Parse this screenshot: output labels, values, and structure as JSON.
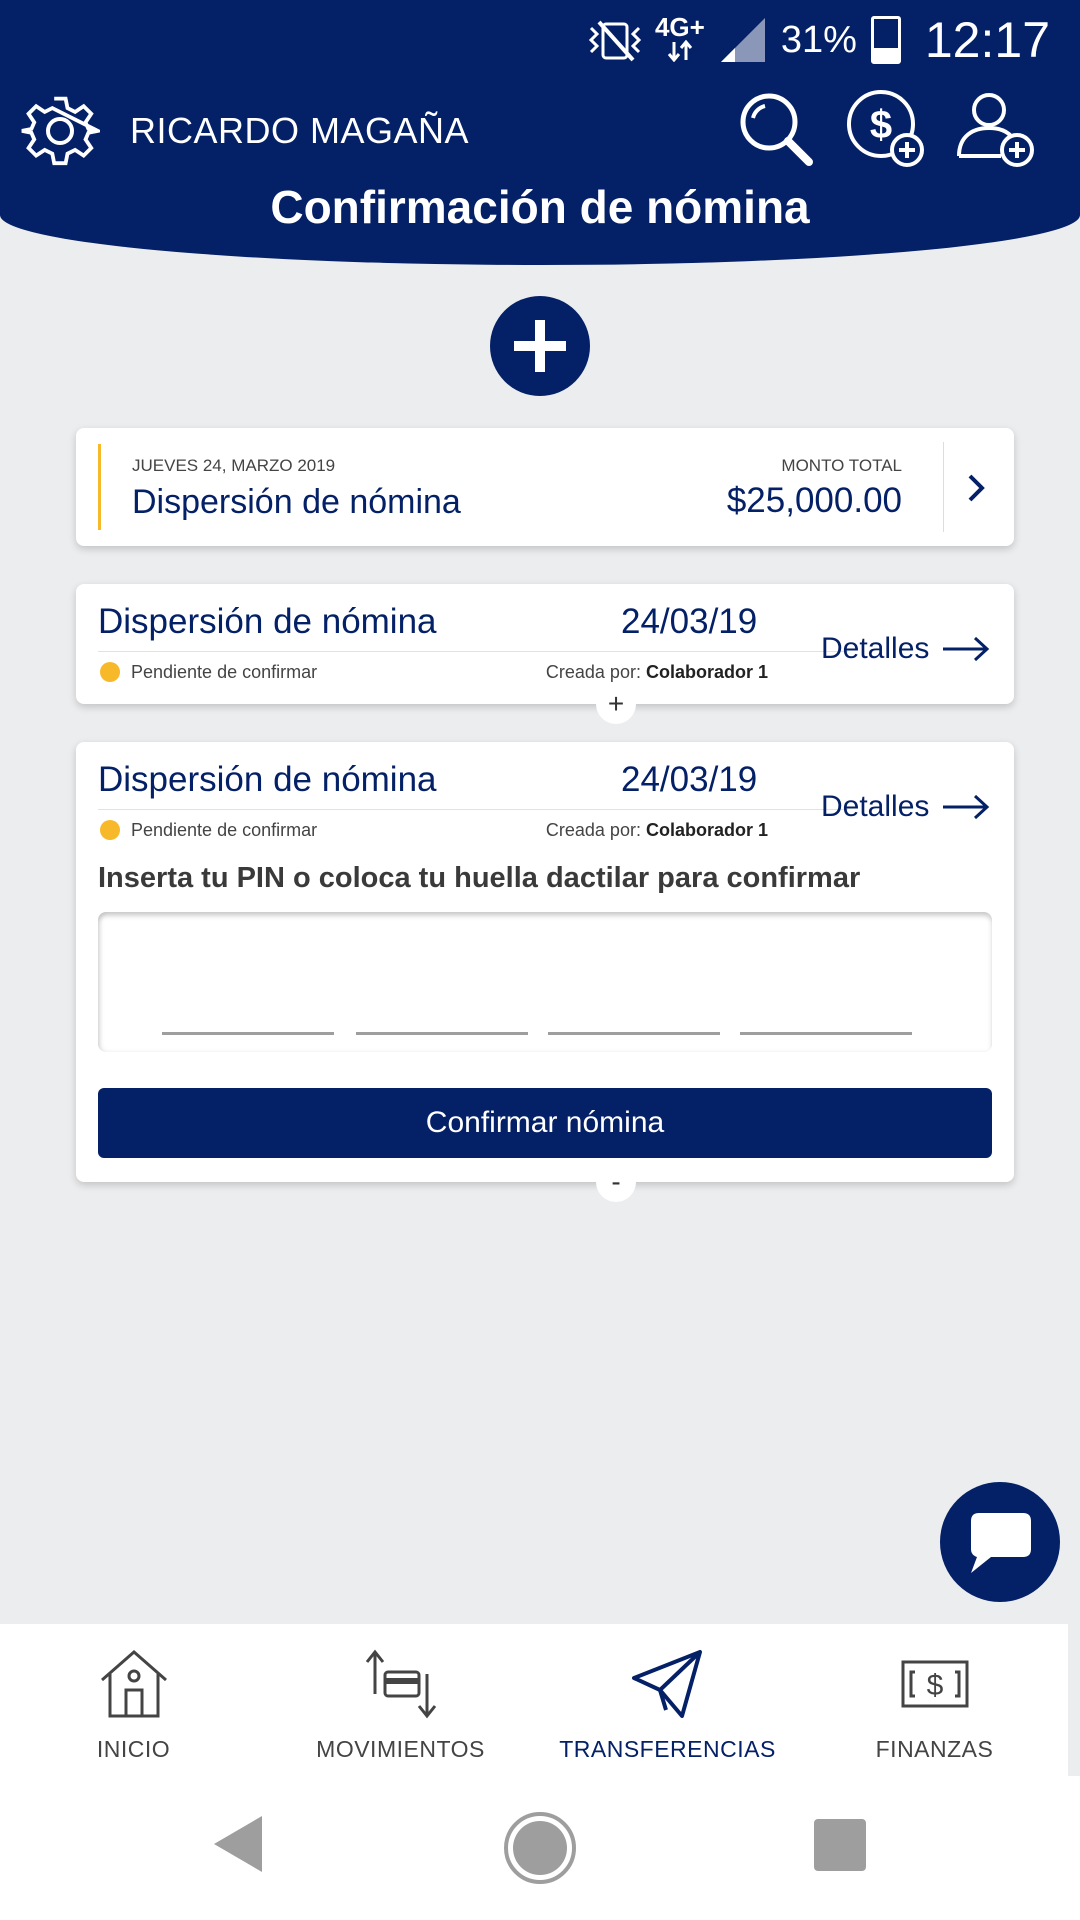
{
  "status_bar": {
    "network": "4G+",
    "battery_percent": "31%",
    "time": "12:17",
    "icons": [
      "vibrate-off-icon",
      "network-arrows-icon",
      "signal-icon",
      "battery-icon"
    ]
  },
  "header": {
    "user_name": "RICARDO MAGAÑA",
    "title": "Confirmación de nómina",
    "icons": [
      "gear-icon",
      "search-icon",
      "add-money-icon",
      "add-user-icon"
    ],
    "color": "#042066"
  },
  "summary": {
    "date": "JUEVES 24, MARZO 2019",
    "title": "Dispersión de nómina",
    "amount_label": "MONTO TOTAL",
    "amount": "$25,000.00"
  },
  "items": [
    {
      "title": "Dispersión de nómina",
      "date": "24/03/19",
      "status": "Pendiente de confirmar",
      "creator_prefix": "Creada por:",
      "creator": "Colaborador 1",
      "details_label": "Detalles",
      "toggle": "+"
    },
    {
      "title": "Dispersión de nómina",
      "date": "24/03/19",
      "status": "Pendiente de confirmar",
      "creator_prefix": "Creada por:",
      "creator": "Colaborador 1",
      "details_label": "Detalles",
      "toggle": "-"
    }
  ],
  "pin": {
    "prompt": "Inserta tu PIN o coloca tu huella dactilar para confirmar",
    "digits": [
      "",
      "",
      "",
      ""
    ],
    "confirm_label": "Confirmar nómina"
  },
  "bottom_nav": [
    {
      "label": "INICIO",
      "icon": "home-icon",
      "active": false
    },
    {
      "label": "MOVIMIENTOS",
      "icon": "movements-icon",
      "active": false
    },
    {
      "label": "TRANSFERENCIAS",
      "icon": "paper-plane-icon",
      "active": true
    },
    {
      "label": "FINANZAS",
      "icon": "money-bill-icon",
      "active": false
    }
  ],
  "accent_color": "#f7b92a"
}
